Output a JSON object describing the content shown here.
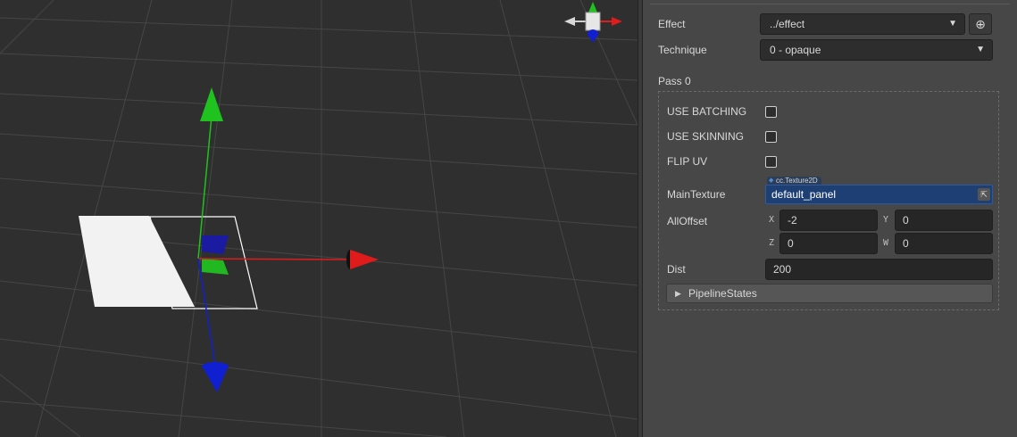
{
  "inspector": {
    "effect": {
      "label": "Effect",
      "value": "../effect",
      "locate_icon": "crosshair-icon"
    },
    "technique": {
      "label": "Technique",
      "value": "0 - opaque"
    },
    "pass": {
      "title": "Pass 0",
      "use_batching": {
        "label": "USE BATCHING",
        "checked": false
      },
      "use_skinning": {
        "label": "USE SKINNING",
        "checked": false
      },
      "flip_uv": {
        "label": "FLIP UV",
        "checked": false
      },
      "main_texture": {
        "label": "MainTexture",
        "type_tag": "cc.Texture2D",
        "value": "default_panel"
      },
      "all_offset": {
        "label": "AllOffset",
        "x_label": "X",
        "x": "-2",
        "y_label": "Y",
        "y": "0",
        "z_label": "Z",
        "z": "0",
        "w_label": "W",
        "w": "0"
      },
      "dist": {
        "label": "Dist",
        "value": "200"
      },
      "pipeline_states": {
        "label": "PipelineStates",
        "expanded": false
      }
    }
  },
  "viewport": {
    "gizmo_colors": {
      "x": "#e01b1b",
      "y": "#1fc21f",
      "z": "#1020d0"
    },
    "background": "#2f2f2f"
  }
}
